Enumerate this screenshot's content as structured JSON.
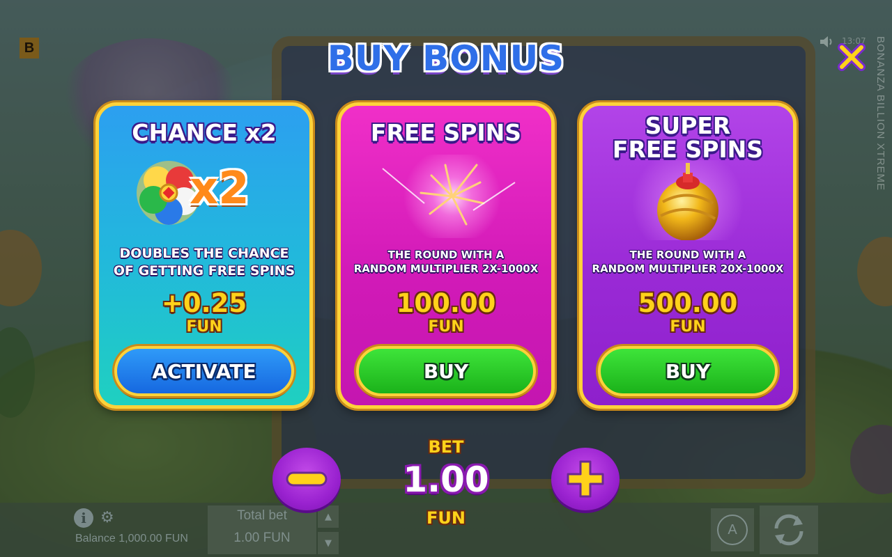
{
  "background": {
    "brand_badge": "B",
    "vertical_title": "BONANZA BILLION XTREME",
    "clock": "13:07"
  },
  "modal": {
    "title": "BUY BONUS",
    "close_icon": "close-icon"
  },
  "cards": [
    {
      "title": "CHANCE x2",
      "art_label": "x2",
      "description_lines": [
        "DOUBLES THE CHANCE",
        "OF GETTING FREE SPINS"
      ],
      "price": "+0.25",
      "currency": "FUN",
      "button_label": "ACTIVATE",
      "color": "#22b8dc"
    },
    {
      "title": "FREE SPINS",
      "description_lines": [
        "THE ROUND WITH A",
        "RANDOM MULTIPLIER 2X-1000X"
      ],
      "price": "100.00",
      "currency": "FUN",
      "button_label": "BUY",
      "color": "#d21ab8"
    },
    {
      "title_lines": [
        "SUPER",
        "FREE SPINS"
      ],
      "description_lines": [
        "THE ROUND WITH A",
        "RANDOM MULTIPLIER 20X-1000X"
      ],
      "price": "500.00",
      "currency": "FUN",
      "button_label": "BUY",
      "color": "#9a2ad6"
    }
  ],
  "bet": {
    "label": "BET",
    "value": "1.00",
    "currency": "FUN"
  },
  "bottom_bar": {
    "balance": "Balance 1,000.00 FUN",
    "total_bet_label": "Total bet",
    "total_bet_value": "1.00 FUN",
    "auto_label": "A"
  }
}
